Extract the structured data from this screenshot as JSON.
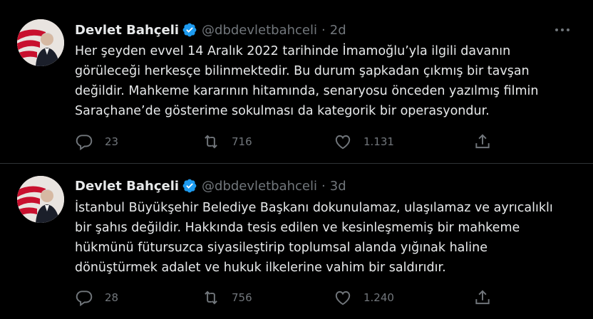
{
  "colors": {
    "background": "#000000",
    "text_primary": "#e7e9ea",
    "text_secondary": "#71767b",
    "verified": "#1d9bf0",
    "divider": "#2f3336"
  },
  "icons": [
    "verified-badge-icon",
    "more-icon",
    "reply-icon",
    "retweet-icon",
    "like-icon",
    "share-icon"
  ],
  "tweets": [
    {
      "name": "Devlet Bahçeli",
      "handle": "@dbdevletbahceli",
      "separator": "·",
      "time": "2d",
      "text": "Her şeyden evvel 14 Aralık 2022 tarihinde İmamoğlu’yla ilgili davanın\ngörüleceği herkesçe bilinmektedir. Bu durum şapkadan çıkmış bir tavşan\ndeğildir. Mahkeme kararının hitamında, senaryosu önceden yazılmış filmin\nSaraçhane’de gösterime sokulması da kategorik bir operasyondur.",
      "replies": "23",
      "retweets": "716",
      "likes": "1.131"
    },
    {
      "name": "Devlet Bahçeli",
      "handle": "@dbdevletbahceli",
      "separator": "·",
      "time": "3d",
      "text": "İstanbul Büyükşehir Belediye Başkanı dokunulamaz, ulaşılamaz ve ayrıcalıklı\nbir şahıs değildir. Hakkında tesis edilen ve kesinleşmemiş bir mahkeme\nhükmünü fütursuzca siyasileştirip toplumsal alanda yığınak haline\ndönüştürmek adalet ve hukuk ilkelerine vahim bir saldırıdır.",
      "replies": "28",
      "retweets": "756",
      "likes": "1.240"
    }
  ]
}
